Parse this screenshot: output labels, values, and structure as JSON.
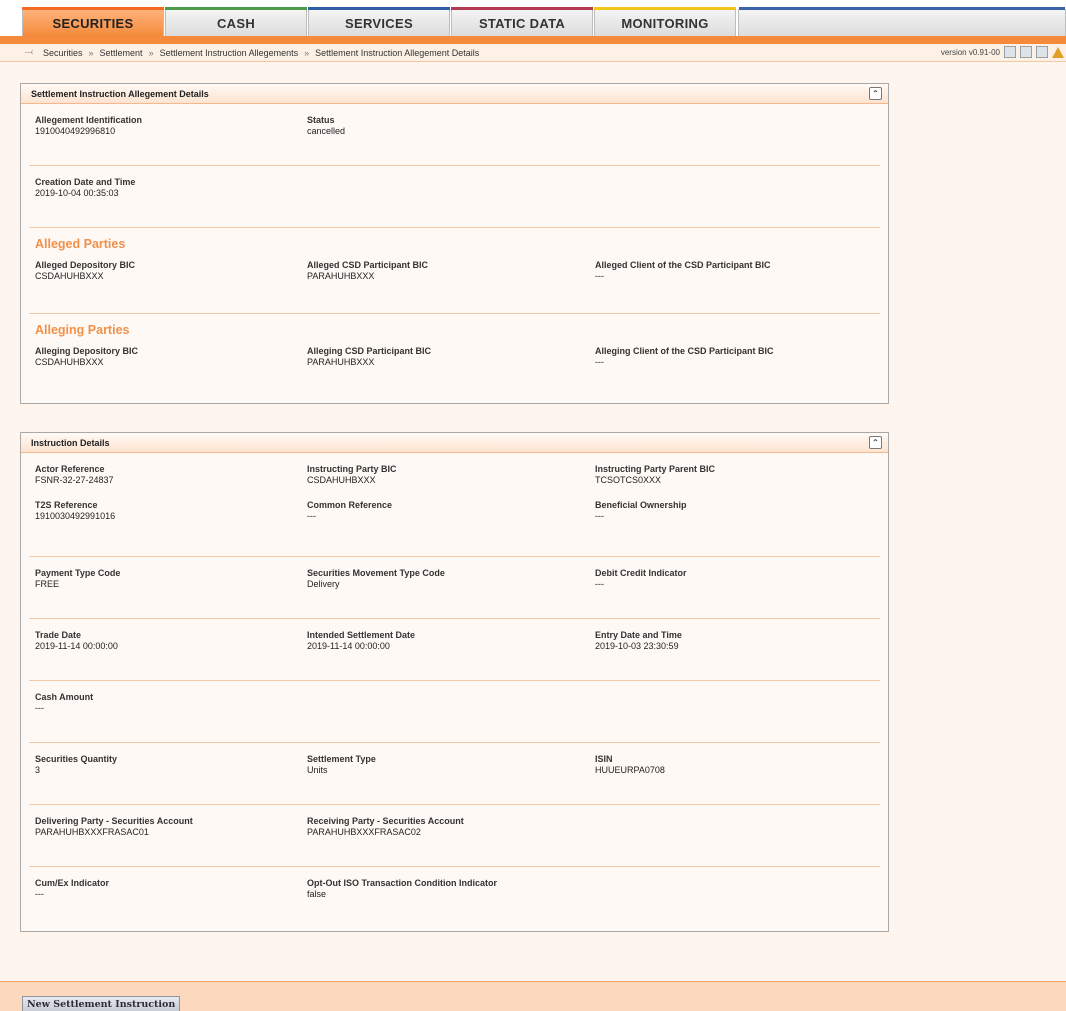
{
  "tabs": [
    "SECURITIES",
    "CASH",
    "SERVICES",
    "STATIC DATA",
    "MONITORING"
  ],
  "breadcrumb": [
    "Securities",
    "Settlement",
    "Settlement Instruction Allegements",
    "Settlement Instruction Allegement Details"
  ],
  "version": "version v0.91-00",
  "allegement_panel": {
    "title": "Settlement Instruction Allegement Details",
    "allegement_identification": {
      "label": "Allegement Identification",
      "value": "1910040492996810"
    },
    "status": {
      "label": "Status",
      "value": "cancelled"
    },
    "creation": {
      "label": "Creation Date and Time",
      "value": "2019-10-04 00:35:03"
    },
    "alleged_parties": {
      "title": "Alleged Parties",
      "depository": {
        "label": "Alleged Depository BIC",
        "value": "CSDAHUHBXXX"
      },
      "csd_participant": {
        "label": "Alleged CSD Participant BIC",
        "value": "PARAHUHBXXX"
      },
      "client": {
        "label": "Alleged Client of the CSD Participant BIC",
        "value": "---"
      }
    },
    "alleging_parties": {
      "title": "Alleging Parties",
      "depository": {
        "label": "Alleging Depository BIC",
        "value": "CSDAHUHBXXX"
      },
      "csd_participant": {
        "label": "Alleging CSD Participant BIC",
        "value": "PARAHUHBXXX"
      },
      "client": {
        "label": "Alleging Client of the CSD Participant BIC",
        "value": "---"
      }
    }
  },
  "instruction_panel": {
    "title": "Instruction Details",
    "actor_reference": {
      "label": "Actor Reference",
      "value": "FSNR-32-27-24837"
    },
    "instructing_party_bic": {
      "label": "Instructing Party BIC",
      "value": "CSDAHUHBXXX"
    },
    "instructing_party_parent_bic": {
      "label": "Instructing Party Parent BIC",
      "value": "TCSOTCS0XXX"
    },
    "t2s_reference": {
      "label": "T2S Reference",
      "value": "1910030492991016"
    },
    "common_reference": {
      "label": "Common Reference",
      "value": "---"
    },
    "beneficial_ownership": {
      "label": "Beneficial Ownership",
      "value": "---"
    },
    "payment_type_code": {
      "label": "Payment Type Code",
      "value": "FREE"
    },
    "securities_movement_type_code": {
      "label": "Securities Movement Type Code",
      "value": "Delivery"
    },
    "debit_credit_indicator": {
      "label": "Debit Credit Indicator",
      "value": "---"
    },
    "trade_date": {
      "label": "Trade Date",
      "value": "2019-11-14 00:00:00"
    },
    "intended_settlement_date": {
      "label": "Intended Settlement Date",
      "value": "2019-11-14 00:00:00"
    },
    "entry_date_time": {
      "label": "Entry Date and Time",
      "value": "2019-10-03 23:30:59"
    },
    "cash_amount": {
      "label": "Cash Amount",
      "value": "---"
    },
    "securities_quantity": {
      "label": "Securities Quantity",
      "value": "3"
    },
    "settlement_type": {
      "label": "Settlement Type",
      "value": "Units"
    },
    "isin": {
      "label": "ISIN",
      "value": "HUUEURPA0708"
    },
    "delivering_account": {
      "label": "Delivering Party - Securities Account",
      "value": "PARAHUHBXXXFRASAC01"
    },
    "receiving_account": {
      "label": "Receiving Party - Securities Account",
      "value": "PARAHUHBXXXFRASAC02"
    },
    "cum_ex_indicator": {
      "label": "Cum/Ex Indicator",
      "value": "---"
    },
    "opt_out": {
      "label": "Opt-Out ISO Transaction Condition Indicator",
      "value": "false"
    }
  },
  "new_button": "New Settlement Instruction"
}
